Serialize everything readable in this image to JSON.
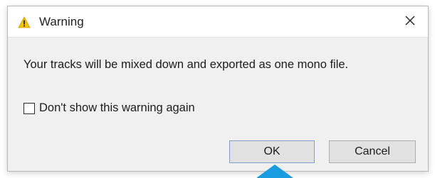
{
  "dialog": {
    "title": "Warning",
    "title_icon": "warning-triangle-icon",
    "close_icon": "close-icon",
    "message": "Your tracks will be mixed down and exported as one mono file.",
    "checkbox": {
      "label": "Don't show this warning again",
      "checked": false
    },
    "buttons": {
      "ok_label": "OK",
      "cancel_label": "Cancel"
    }
  },
  "colors": {
    "warning_yellow": "#f5c400",
    "pointer_blue": "#1a9ce0",
    "dialog_background": "#f0f0f0",
    "titlebar_background": "#ffffff"
  }
}
